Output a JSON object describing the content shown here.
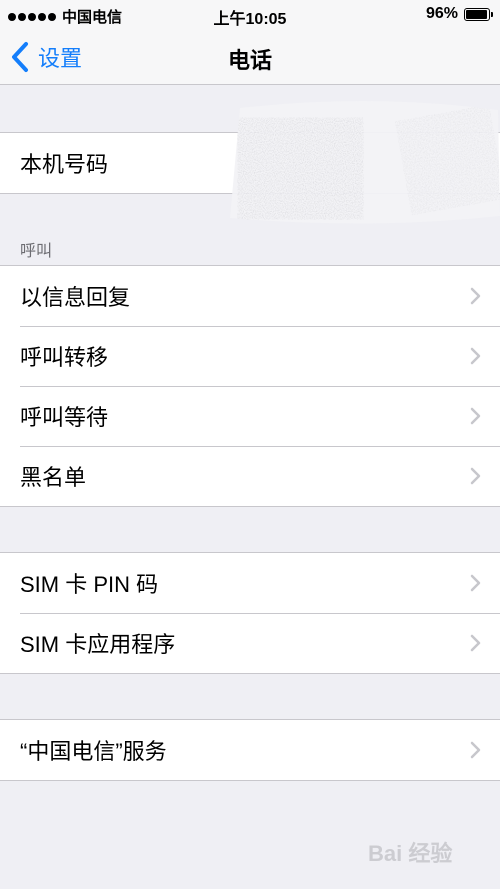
{
  "status_bar": {
    "carrier": "中国电信",
    "time": "上午10:05",
    "battery_percent_text": "96%",
    "battery_level": 0.96
  },
  "nav": {
    "back_label": "设置",
    "title": "电话"
  },
  "group_number": {
    "items": [
      {
        "label": "本机号码"
      }
    ]
  },
  "section_call": {
    "header": "呼叫",
    "items": [
      {
        "label": "以信息回复"
      },
      {
        "label": "呼叫转移"
      },
      {
        "label": "呼叫等待"
      },
      {
        "label": "黑名单"
      }
    ]
  },
  "group_sim": {
    "items": [
      {
        "label": "SIM 卡 PIN 码"
      },
      {
        "label": "SIM 卡应用程序"
      }
    ]
  },
  "group_carrier": {
    "items": [
      {
        "label": "“中国电信”服务"
      }
    ]
  },
  "watermark": {
    "text": "Bai  经验"
  },
  "colors": {
    "accent": "#147efb",
    "background": "#efeff4",
    "separator": "#c8c7cc",
    "chevron": "#c7c7cc"
  },
  "icons": [
    "chevron-left-icon",
    "chevron-right-icon",
    "battery-icon",
    "signal-icon"
  ]
}
